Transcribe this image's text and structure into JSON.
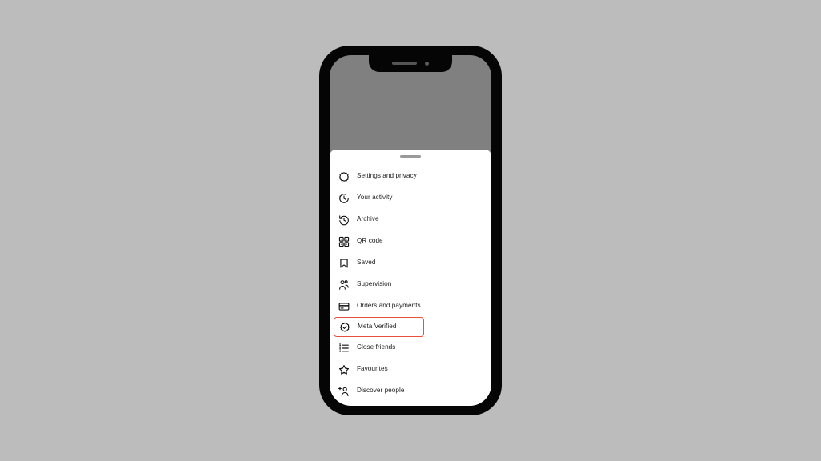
{
  "background_color": "#bcbcbc",
  "device": {
    "name": "smartphone-mockup",
    "frame_color": "#050505",
    "screen_color": "#808080",
    "notch": {
      "speaker_label": "earpiece-speaker",
      "camera_label": "front-camera"
    }
  },
  "sheet": {
    "name": "instagram-menu-bottom-sheet",
    "background_color": "#ffffff",
    "handle_label": "drag-handle"
  },
  "highlight": {
    "color": "#e8503a",
    "target_label": "Meta Verified"
  },
  "menu": {
    "items": [
      {
        "label": "Settings and privacy",
        "icon": "settings-gear-icon",
        "highlighted": false
      },
      {
        "label": "Your activity",
        "icon": "activity-clock-icon",
        "highlighted": false
      },
      {
        "label": "Archive",
        "icon": "archive-clock-back-icon",
        "highlighted": false
      },
      {
        "label": "QR code",
        "icon": "qr-code-icon",
        "highlighted": false
      },
      {
        "label": "Saved",
        "icon": "bookmark-icon",
        "highlighted": false
      },
      {
        "label": "Supervision",
        "icon": "supervision-people-icon",
        "highlighted": false
      },
      {
        "label": "Orders and payments",
        "icon": "credit-card-icon",
        "highlighted": false
      },
      {
        "label": "Meta Verified",
        "icon": "verified-badge-icon",
        "highlighted": true
      },
      {
        "label": "Close friends",
        "icon": "close-friends-list-icon",
        "highlighted": false
      },
      {
        "label": "Favourites",
        "icon": "star-icon",
        "highlighted": false
      },
      {
        "label": "Discover people",
        "icon": "discover-people-add-icon",
        "highlighted": false
      }
    ]
  }
}
